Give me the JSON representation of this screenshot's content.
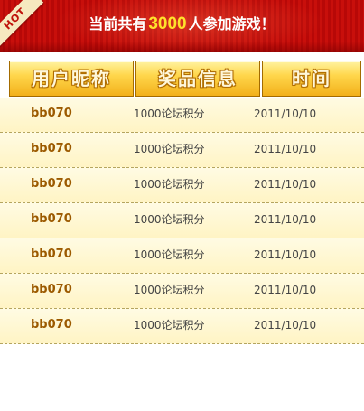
{
  "banner": {
    "hot_label": "HOT",
    "headline_prefix": "当前共有",
    "participant_count": "3000",
    "headline_suffix": "人参加游戏！"
  },
  "table": {
    "headers": [
      "用户昵称",
      "奖品信息",
      "时间"
    ],
    "rows": [
      {
        "user": "bb070",
        "prize": "1000论坛积分",
        "date": "2011/10/10"
      },
      {
        "user": "bb070",
        "prize": "1000论坛积分",
        "date": "2011/10/10"
      },
      {
        "user": "bb070",
        "prize": "1000论坛积分",
        "date": "2011/10/10"
      },
      {
        "user": "bb070",
        "prize": "1000论坛积分",
        "date": "2011/10/10"
      },
      {
        "user": "bb070",
        "prize": "1000论坛积分",
        "date": "2011/10/10"
      },
      {
        "user": "bb070",
        "prize": "1000论坛积分",
        "date": "2011/10/10"
      },
      {
        "user": "bb070",
        "prize": "1000论坛积分",
        "date": "2011/10/10"
      }
    ]
  },
  "colors": {
    "banner_red": "#c80f0b",
    "count_yellow": "#ffe22b",
    "header_gold": "#ffd74c",
    "username_brown": "#9c5a00",
    "row_cream": "#fff4c4"
  }
}
